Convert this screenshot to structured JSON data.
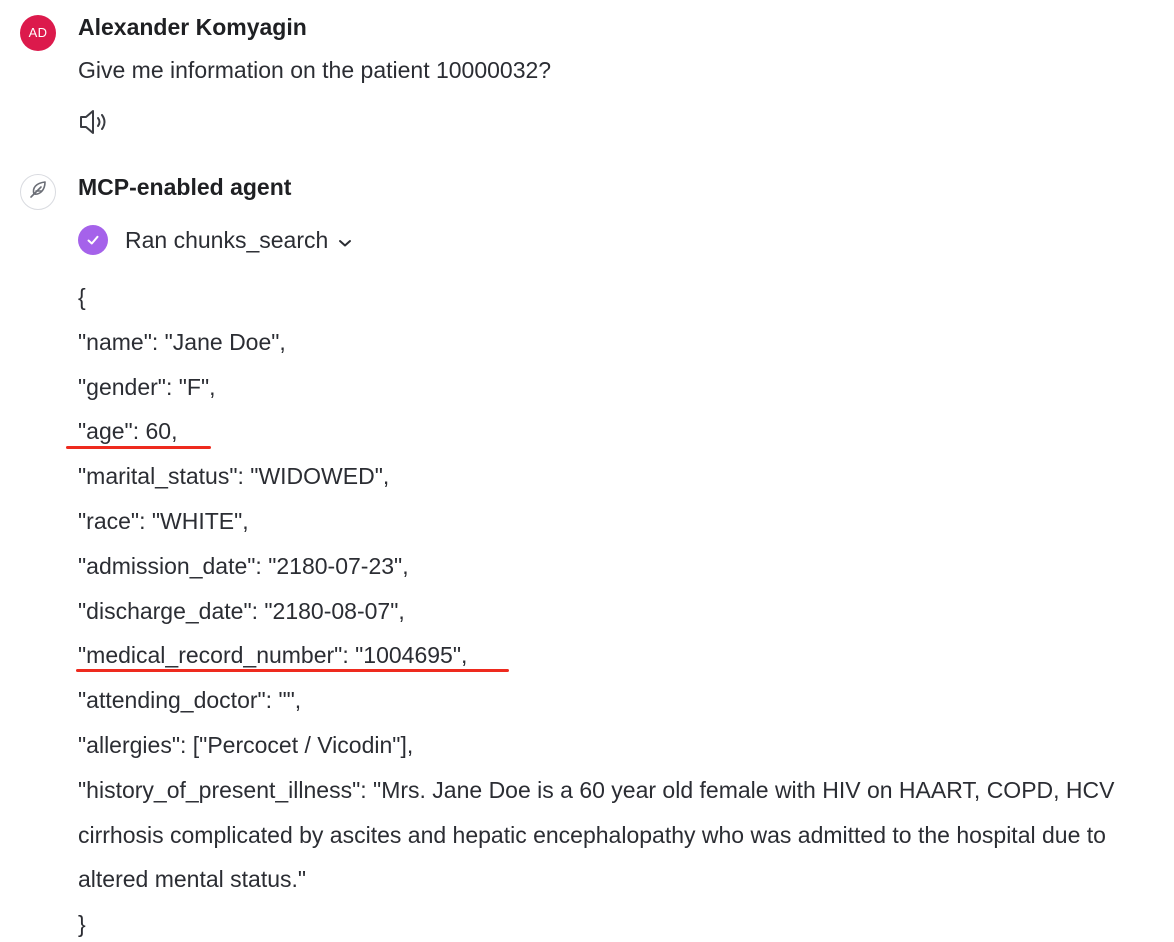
{
  "user_message": {
    "avatar_initials": "AD",
    "author": "Alexander Komyagin",
    "text": "Give me information on the patient 10000032?",
    "speaker_icon": "speaker-icon"
  },
  "agent_message": {
    "avatar_icon": "feather-icon",
    "author": "MCP-enabled agent",
    "tool_call": {
      "status_icon": "check-circle-icon",
      "label": "Ran chunks_search",
      "toggle_icon": "chevron-down-icon"
    },
    "code_lines": [
      "{",
      "\"name\": \"Jane Doe\",",
      "\"gender\": \"F\",",
      "\"age\": 60,",
      "\"marital_status\": \"WIDOWED\",",
      "\"race\": \"WHITE\",",
      "\"admission_date\": \"2180-07-23\",",
      "\"discharge_date\": \"2180-08-07\",",
      "\"medical_record_number\": \"1004695\",",
      "\"attending_doctor\": \"\",",
      "\"allergies\": [\"Percocet / Vicodin\"],",
      "\"history_of_present_illness\": \"Mrs. Jane Doe is a 60 year old female with HIV on HAART, COPD, HCV cirrhosis complicated by ascites and hepatic encephalopathy who was admitted to the hospital due to altered mental status.\"",
      "}"
    ]
  },
  "colors": {
    "user_avatar": "#dc1a4c",
    "tool_check": "#a562ea",
    "annotation_underline": "#ee2a1e"
  }
}
